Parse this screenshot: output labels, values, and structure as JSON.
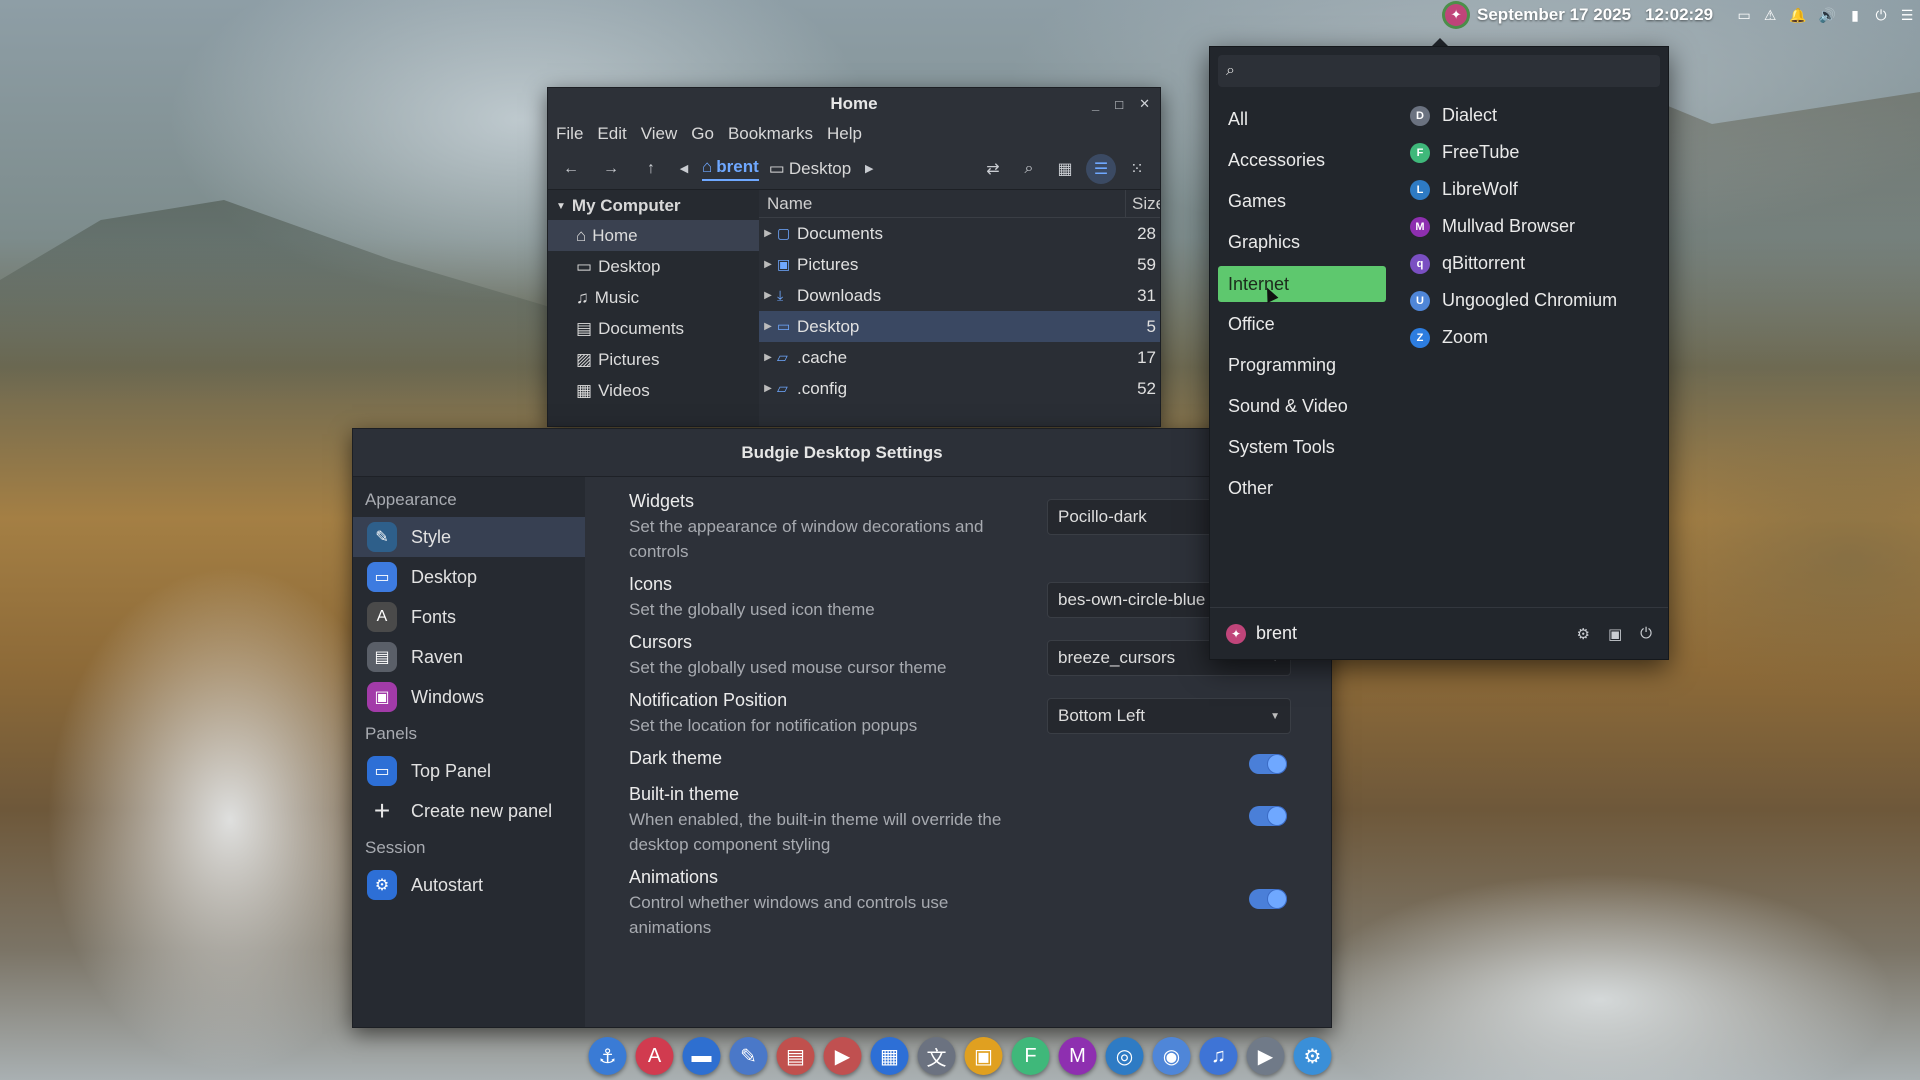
{
  "top_panel": {
    "date": "September 17 2025",
    "time": "12:02:29",
    "tray_icons": [
      "workspace-icon",
      "updates-icon",
      "notification-bell-icon",
      "volume-icon",
      "battery-icon",
      "power-icon",
      "menu-icon"
    ],
    "tray_glyphs": [
      "▭",
      "⚠",
      "🔔",
      "🔊",
      "▮",
      "⏻",
      "☰"
    ]
  },
  "file_manager": {
    "title": "Home",
    "menu": [
      "File",
      "Edit",
      "View",
      "Go",
      "Bookmarks",
      "Help"
    ],
    "breadcrumbs": [
      "brent",
      "Desktop"
    ],
    "sidebar_heading": "My Computer",
    "sidebar_items": [
      {
        "label": "Home",
        "icon": "⌂"
      },
      {
        "label": "Desktop",
        "icon": "▭"
      },
      {
        "label": "Music",
        "icon": "♫"
      },
      {
        "label": "Documents",
        "icon": "▤"
      },
      {
        "label": "Pictures",
        "icon": "▨"
      },
      {
        "label": "Videos",
        "icon": "▦"
      }
    ],
    "columns": {
      "name": "Name",
      "size": "Size"
    },
    "rows": [
      {
        "name": "Documents",
        "size": "28",
        "icon": "▢"
      },
      {
        "name": "Pictures",
        "size": "59",
        "icon": "▣"
      },
      {
        "name": "Downloads",
        "size": "31",
        "icon": "⤓"
      },
      {
        "name": "Desktop",
        "size": "5",
        "icon": "▭"
      },
      {
        "name": ".cache",
        "size": "17",
        "icon": "▱"
      },
      {
        "name": ".config",
        "size": "52",
        "icon": "▱"
      }
    ]
  },
  "settings": {
    "title": "Budgie Desktop Settings",
    "sections": {
      "appearance": "Appearance",
      "panels": "Panels",
      "session": "Session"
    },
    "appearance_items": [
      {
        "label": "Style",
        "glyph": "✎",
        "color": "#2e5f8a"
      },
      {
        "label": "Desktop",
        "glyph": "▭",
        "color": "#3d7be0"
      },
      {
        "label": "Fonts",
        "glyph": "A",
        "color": "#4a4a4a"
      },
      {
        "label": "Raven",
        "glyph": "▤",
        "color": "#5a5f68"
      },
      {
        "label": "Windows",
        "glyph": "▣",
        "color": "#a23ba8"
      }
    ],
    "panel_items": [
      {
        "label": "Top Panel",
        "glyph": "▭",
        "color": "#2d6fd6"
      },
      {
        "label": "Create new panel",
        "glyph": "+",
        "color": "transparent"
      }
    ],
    "session_items": [
      {
        "label": "Autostart",
        "glyph": "⚙",
        "color": "#2d6fd6"
      }
    ],
    "options": [
      {
        "label": "Widgets",
        "desc": "Set the appearance of window decorations and controls",
        "value": "Pocillo-dark"
      },
      {
        "label": "Icons",
        "desc": "Set the globally used icon theme",
        "value": "bes-own-circle-blue"
      },
      {
        "label": "Cursors",
        "desc": "Set the globally used mouse cursor theme",
        "value": "breeze_cursors"
      },
      {
        "label": "Notification Position",
        "desc": "Set the location for notification popups",
        "value": "Bottom Left"
      }
    ],
    "toggles": [
      {
        "label": "Dark theme",
        "desc": ""
      },
      {
        "label": "Built-in theme",
        "desc": "When enabled, the built-in theme will override the desktop component styling"
      },
      {
        "label": "Animations",
        "desc": "Control whether windows and controls use animations"
      }
    ]
  },
  "app_menu": {
    "search_placeholder": "",
    "categories": [
      "All",
      "Accessories",
      "Games",
      "Graphics",
      "Internet",
      "Office",
      "Programming",
      "Sound & Video",
      "System Tools",
      "Other"
    ],
    "selected_category": "Internet",
    "apps": [
      {
        "name": "Dialect",
        "color": "#6b7280",
        "glyph": "D"
      },
      {
        "name": "FreeTube",
        "color": "#3fb87a",
        "glyph": "F"
      },
      {
        "name": "LibreWolf",
        "color": "#2e7bc4",
        "glyph": "L"
      },
      {
        "name": "Mullvad Browser",
        "color": "#8e2fb0",
        "glyph": "M"
      },
      {
        "name": "qBittorrent",
        "color": "#7a4fc2",
        "glyph": "q"
      },
      {
        "name": "Ungoogled Chromium",
        "color": "#4f86d8",
        "glyph": "U"
      },
      {
        "name": "Zoom",
        "color": "#2d7de0",
        "glyph": "Z"
      }
    ],
    "user": "brent"
  },
  "dock": [
    {
      "name": "anchor",
      "glyph": "⚓",
      "color": "#3a7bd5"
    },
    {
      "name": "app-a",
      "glyph": "A",
      "color": "#d13b4f"
    },
    {
      "name": "files",
      "glyph": "▬",
      "color": "#2e6fd0"
    },
    {
      "name": "text-editor",
      "glyph": "✎",
      "color": "#4a78c8"
    },
    {
      "name": "documents",
      "glyph": "▤",
      "color": "#c0504d"
    },
    {
      "name": "media",
      "glyph": "▶",
      "color": "#c05050"
    },
    {
      "name": "grid",
      "glyph": "▦",
      "color": "#2d6fd6"
    },
    {
      "name": "translator",
      "glyph": "文",
      "color": "#6b7280"
    },
    {
      "name": "notes",
      "glyph": "▣",
      "color": "#e0a020"
    },
    {
      "name": "freetube",
      "glyph": "F",
      "color": "#3fb87a"
    },
    {
      "name": "mullvad",
      "glyph": "M",
      "color": "#8e2fb0"
    },
    {
      "name": "librewolf",
      "glyph": "◎",
      "color": "#2e7bc4"
    },
    {
      "name": "chromium",
      "glyph": "◉",
      "color": "#4f86d8"
    },
    {
      "name": "music",
      "glyph": "♫",
      "color": "#3e74d6"
    },
    {
      "name": "video",
      "glyph": "▶",
      "color": "#707a88"
    },
    {
      "name": "settings",
      "glyph": "⚙",
      "color": "#3a8fd8"
    }
  ]
}
